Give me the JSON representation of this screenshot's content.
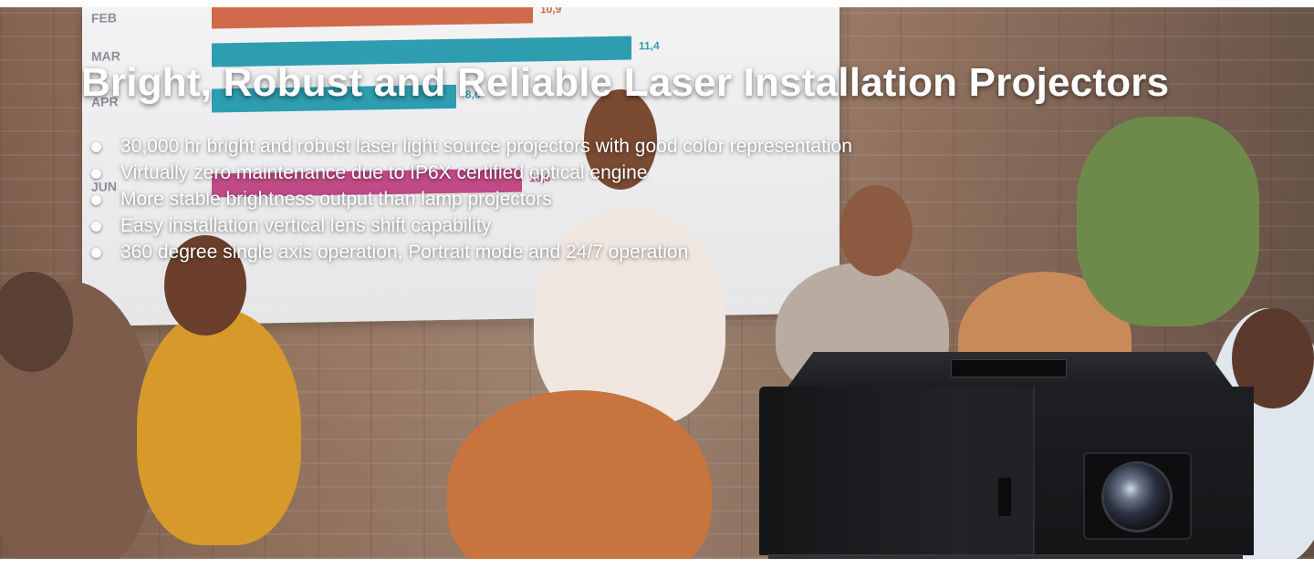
{
  "hero": {
    "title": "Bright, Robust and Reliable Laser Installation Projectors",
    "bullets": [
      "30,000 hr bright and robust laser light source projectors with good color representation",
      "Virtually zero maintenance due to IP6X certified optical engine",
      "More stable brightness output than lamp projectors",
      "Easy installation vertical lens shift capability",
      "360 degree single axis operation, Portrait mode and 24/7 operation"
    ]
  },
  "background_chart": {
    "rows": [
      {
        "label": "FEB",
        "value": "10,9",
        "color": "#d06a4a"
      },
      {
        "label": "MAR",
        "value": "11,4",
        "color": "#2e9db0"
      },
      {
        "label": "APR",
        "value": "8,6",
        "color": "#2e9db0"
      },
      {
        "label": "JUN",
        "value": "10,6",
        "color": "#c04b86"
      }
    ]
  }
}
